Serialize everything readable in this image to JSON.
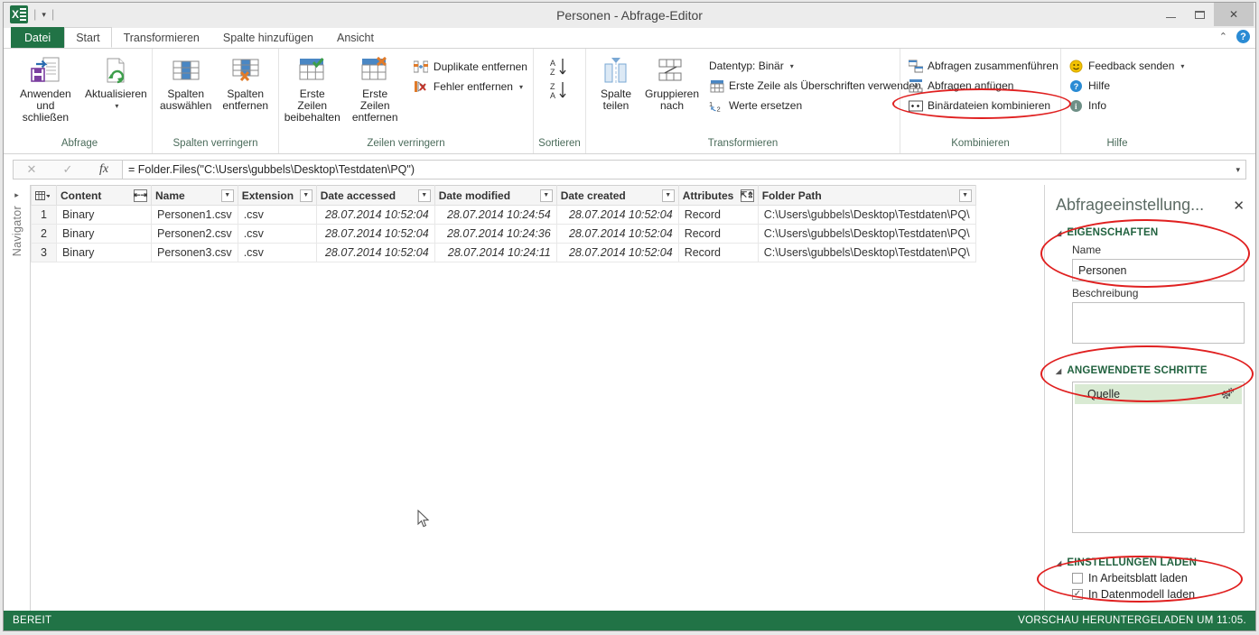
{
  "window": {
    "title": "Personen - Abfrage-Editor",
    "minimize": "–",
    "maximize": "□",
    "close": "✕",
    "qat_separator": "|",
    "qat_caret": "▾"
  },
  "tabs": [
    {
      "label": "Datei",
      "type": "file"
    },
    {
      "label": "Start",
      "type": "active"
    },
    {
      "label": "Transformieren",
      "type": "normal"
    },
    {
      "label": "Spalte hinzufügen",
      "type": "normal"
    },
    {
      "label": "Ansicht",
      "type": "normal"
    }
  ],
  "tabs_right": {
    "collapse": "⌃",
    "help": "?"
  },
  "ribbon": {
    "groups": [
      {
        "name": "Abfrage",
        "label": "Abfrage",
        "big_buttons": [
          {
            "label_line1": "Anwenden",
            "label_line2": "und schließen",
            "icon": "apply-close-icon",
            "caret": false
          },
          {
            "label_line1": "Aktualisieren",
            "label_line2": "",
            "icon": "refresh-icon",
            "caret": true
          }
        ]
      },
      {
        "name": "Spalten verringern",
        "label": "Spalten verringern",
        "big_buttons": [
          {
            "label_line1": "Spalten",
            "label_line2": "auswählen",
            "icon": "choose-columns-icon",
            "caret": false
          },
          {
            "label_line1": "Spalten",
            "label_line2": "entfernen",
            "icon": "remove-columns-icon",
            "caret": true
          }
        ]
      },
      {
        "name": "Zeilen verringern",
        "label": "Zeilen verringern",
        "big_buttons": [
          {
            "label_line1": "Erste Zeilen",
            "label_line2": "beibehalten",
            "icon": "keep-rows-icon",
            "caret": true
          },
          {
            "label_line1": "Erste Zeilen",
            "label_line2": "entfernen",
            "icon": "remove-rows-icon",
            "caret": true
          }
        ],
        "small_buttons": [
          {
            "label": "Duplikate entfernen",
            "icon": "remove-duplicates-icon",
            "caret": false
          },
          {
            "label": "Fehler entfernen",
            "icon": "remove-errors-icon",
            "caret": true
          }
        ]
      },
      {
        "name": "Sortieren",
        "label": "Sortieren",
        "sort_asc": "A\nZ ↓",
        "sort_desc": "Z\nA ↓"
      },
      {
        "name": "Transformieren",
        "label": "Transformieren",
        "big_buttons": [
          {
            "label_line1": "Spalte",
            "label_line2": "teilen",
            "icon": "split-column-icon",
            "caret": true
          },
          {
            "label_line1": "Gruppieren",
            "label_line2": "nach",
            "icon": "group-by-icon",
            "caret": false
          }
        ],
        "small_buttons": [
          {
            "label": "Datentyp: Binär",
            "icon": "datatype-icon",
            "caret": true
          },
          {
            "label": "Erste Zeile als Überschriften verwenden",
            "icon": "first-row-header-icon",
            "caret": false
          },
          {
            "label": "Werte ersetzen",
            "icon": "replace-values-icon",
            "caret": false
          }
        ]
      },
      {
        "name": "Kombinieren",
        "label": "Kombinieren",
        "small_buttons": [
          {
            "label": "Abfragen zusammenführen",
            "icon": "merge-queries-icon",
            "caret": false
          },
          {
            "label": "Abfragen anfügen",
            "icon": "append-queries-icon",
            "caret": false
          },
          {
            "label": "Binärdateien kombinieren",
            "icon": "combine-binaries-icon",
            "caret": false
          }
        ]
      },
      {
        "name": "Hilfe",
        "label": "Hilfe",
        "small_buttons": [
          {
            "label": "Feedback senden",
            "icon": "feedback-icon",
            "caret": true
          },
          {
            "label": "Hilfe",
            "icon": "help-icon",
            "caret": false
          },
          {
            "label": "Info",
            "icon": "info-icon",
            "caret": false
          }
        ]
      }
    ]
  },
  "formula_bar": {
    "cancel_icon": "✕",
    "accept_icon": "✓",
    "fx_icon": "fx",
    "value": "= Folder.Files(\"C:\\Users\\gubbels\\Desktop\\Testdaten\\PQ\")",
    "dropdown_icon": "▾"
  },
  "navigator": {
    "arrow": "▸",
    "label": "Navigator"
  },
  "grid": {
    "columns": [
      {
        "label": "Content",
        "button": "expand"
      },
      {
        "label": "Name",
        "button": "filter"
      },
      {
        "label": "Extension",
        "button": "filter"
      },
      {
        "label": "Date accessed",
        "button": "filter"
      },
      {
        "label": "Date modified",
        "button": "filter"
      },
      {
        "label": "Date created",
        "button": "filter"
      },
      {
        "label": "Attributes",
        "button": "expand2"
      },
      {
        "label": "Folder Path",
        "button": "filter"
      }
    ],
    "rows": [
      {
        "num": "1",
        "content": "Binary",
        "name": "Personen1.csv",
        "extension": ".csv",
        "date_accessed": "28.07.2014 10:52:04",
        "date_modified": "28.07.2014 10:24:54",
        "date_created": "28.07.2014 10:52:04",
        "attributes": "Record",
        "folder_path": "C:\\Users\\gubbels\\Desktop\\Testdaten\\PQ\\"
      },
      {
        "num": "2",
        "content": "Binary",
        "name": "Personen2.csv",
        "extension": ".csv",
        "date_accessed": "28.07.2014 10:52:04",
        "date_modified": "28.07.2014 10:24:36",
        "date_created": "28.07.2014 10:52:04",
        "attributes": "Record",
        "folder_path": "C:\\Users\\gubbels\\Desktop\\Testdaten\\PQ\\"
      },
      {
        "num": "3",
        "content": "Binary",
        "name": "Personen3.csv",
        "extension": ".csv",
        "date_accessed": "28.07.2014 10:52:04",
        "date_modified": "28.07.2014 10:24:11",
        "date_created": "28.07.2014 10:52:04",
        "attributes": "Record",
        "folder_path": "C:\\Users\\gubbels\\Desktop\\Testdaten\\PQ\\"
      }
    ]
  },
  "right_pane": {
    "title": "Abfrageeinstellung...",
    "close_icon": "✕",
    "properties": {
      "section": "EIGENSCHAFTEN",
      "name_label": "Name",
      "name_value": "Personen",
      "description_label": "Beschreibung",
      "description_value": ""
    },
    "applied_steps": {
      "section": "ANGEWENDETE SCHRITTE",
      "steps": [
        {
          "label": "Quelle",
          "gear": "⚙"
        }
      ]
    },
    "load_settings": {
      "section": "EINSTELLUNGEN LADEN",
      "items": [
        {
          "label": "In Arbeitsblatt laden",
          "checked": false
        },
        {
          "label": "In Datenmodell laden",
          "checked": true
        }
      ],
      "check_glyph": "✓"
    }
  },
  "status_bar": {
    "left": "BEREIT",
    "right": "VORSCHAU HERUNTERGELADEN UM 11:05."
  },
  "colors": {
    "excel_green": "#217346",
    "status_green": "#217346",
    "accent_blue": "#2a8bd4",
    "annotation_red": "#e02020",
    "step_highlight": "#d9ead3"
  }
}
